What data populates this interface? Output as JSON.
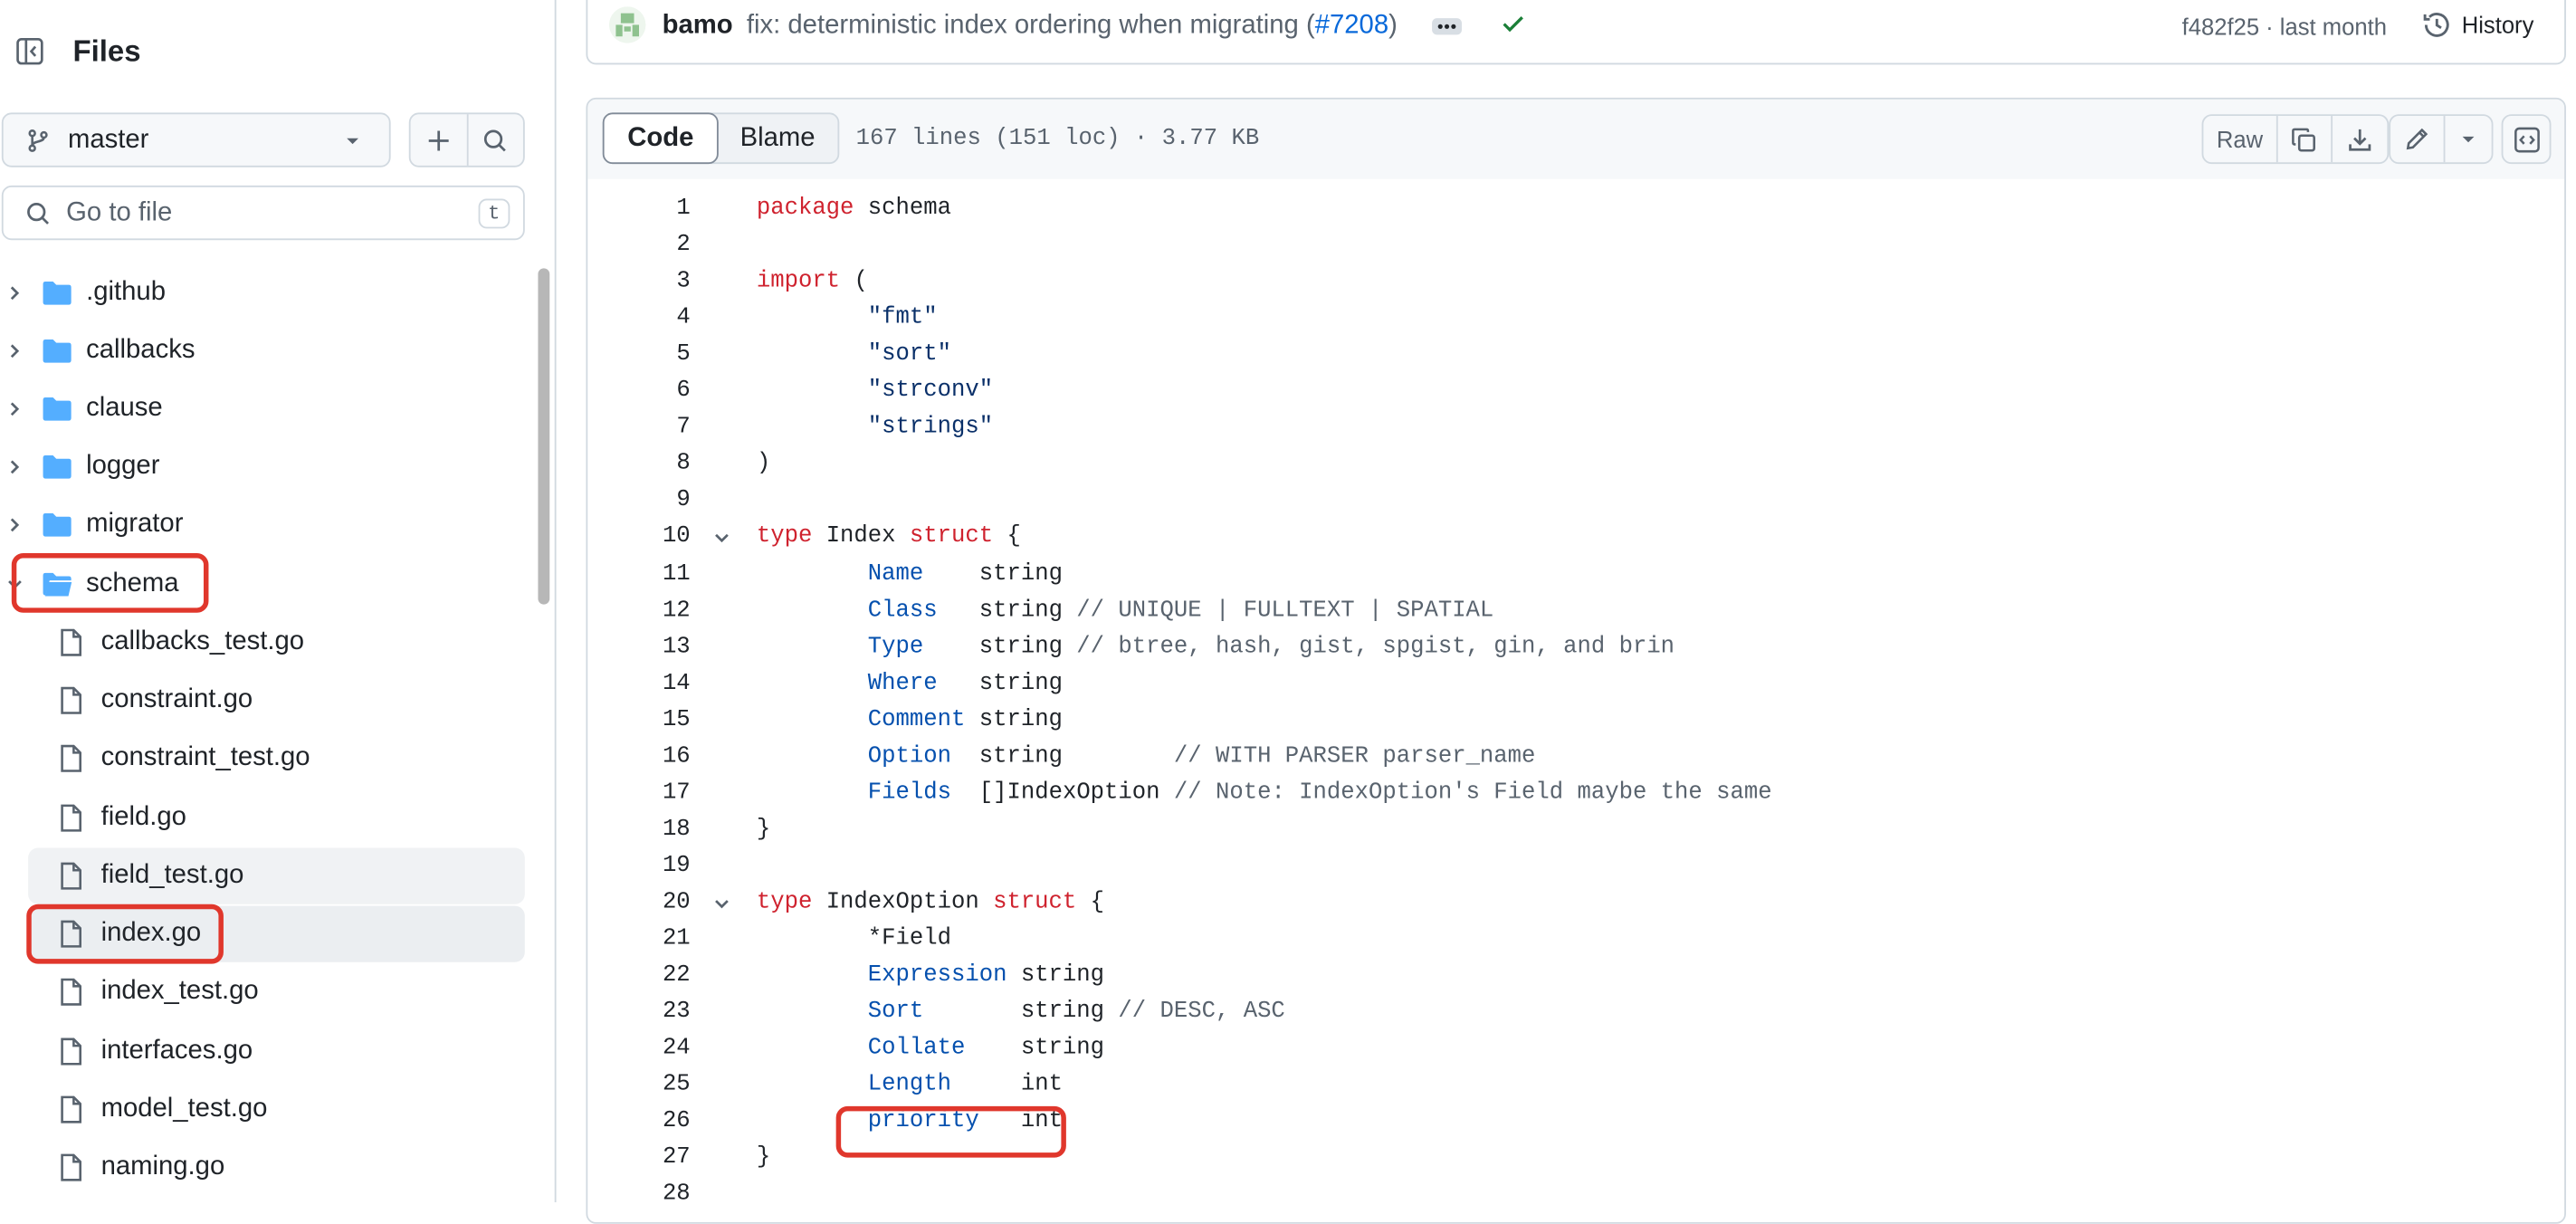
{
  "sidebar": {
    "title": "Files",
    "branch": "master",
    "goto_placeholder": "Go to file",
    "goto_shortcut": "t",
    "folders": [
      ".github",
      "callbacks",
      "clause",
      "logger",
      "migrator",
      "schema"
    ],
    "files": [
      "callbacks_test.go",
      "constraint.go",
      "constraint_test.go",
      "field.go",
      "field_test.go",
      "index.go",
      "index_test.go",
      "interfaces.go",
      "model_test.go",
      "naming.go"
    ],
    "expanded_folder": "schema",
    "selected_file": "index.go"
  },
  "commit": {
    "author": "bamo",
    "message": "fix: deterministic index ordering when migrating (",
    "pr": "#7208",
    "message_end": ")",
    "sha_time": "f482f25 · last month",
    "history_label": "History"
  },
  "viewer": {
    "tabs": [
      "Code",
      "Blame"
    ],
    "active_tab": "Code",
    "meta": "167 lines (151 loc) · 3.77 KB",
    "raw_label": "Raw"
  },
  "code": {
    "line_numbers": [
      "1",
      "2",
      "3",
      "4",
      "5",
      "6",
      "7",
      "8",
      "9",
      "10",
      "11",
      "12",
      "13",
      "14",
      "15",
      "16",
      "17",
      "18",
      "19",
      "20",
      "21",
      "22",
      "23",
      "24",
      "25",
      "26",
      "27",
      "28"
    ],
    "lines": [
      "package schema",
      "",
      "import (",
      "\t\"fmt\"",
      "\t\"sort\"",
      "\t\"strconv\"",
      "\t\"strings\"",
      ")",
      "",
      "type Index struct {",
      "\tName    string",
      "\tClass   string // UNIQUE | FULLTEXT | SPATIAL",
      "\tType    string // btree, hash, gist, spgist, gin, and brin",
      "\tWhere   string",
      "\tComment string",
      "\tOption  string        // WITH PARSER parser_name",
      "\tFields  []IndexOption // Note: IndexOption's Field maybe the same",
      "}",
      "",
      "type IndexOption struct {",
      "\t*Field",
      "\tExpression string",
      "\tSort       string // DESC, ASC",
      "\tCollate    string",
      "\tLength     int",
      "\tpriority   int",
      "}",
      ""
    ]
  },
  "colors": {
    "keyword": "#cf222e",
    "string": "#0a3069",
    "field": "#0550ae",
    "comment": "#59636e",
    "highlight_box": "#e0372c"
  }
}
